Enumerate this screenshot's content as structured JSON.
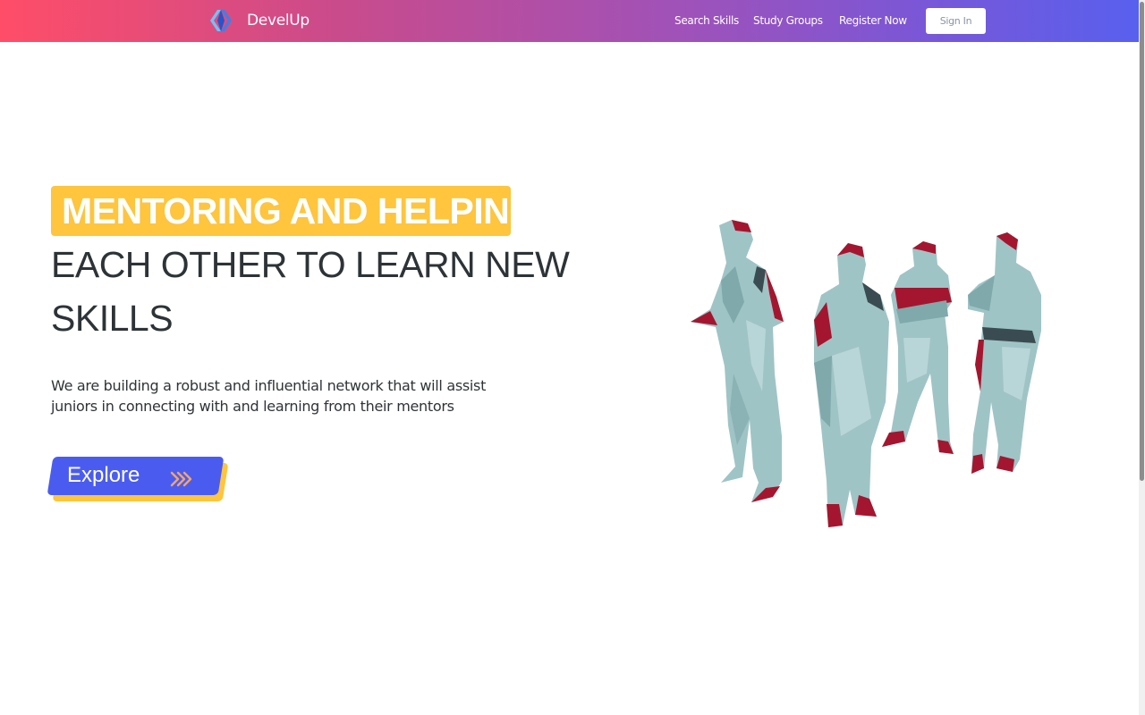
{
  "brand": {
    "name": "DevelUp",
    "logo_icon": "code-brackets-icon"
  },
  "nav": {
    "links": [
      "Search Skills",
      "Study Groups",
      "Register Now"
    ],
    "signin_label": "Sign In"
  },
  "hero": {
    "headline_highlight": "MENTORING AND HELPING",
    "headline_line2": "EACH OTHER TO LEARN NEW",
    "headline_line3": "SKILLS",
    "tagline": "We are building a robust and influential network that will assist juniors in connecting with and learning from their mentors",
    "cta_label": "Explore",
    "cta_icon": "chevrons-right-icon",
    "illustration": "people-lowpoly-illustration"
  },
  "colors": {
    "nav_gradient": [
      "#ff4d68",
      "#9f52b9",
      "#5860ee"
    ],
    "highlight": "#fec53d",
    "cta": "#4a5cf0",
    "arrow": "#f3a56b",
    "figure_body": "#9fc4c6",
    "figure_accent": "#a4162f"
  }
}
